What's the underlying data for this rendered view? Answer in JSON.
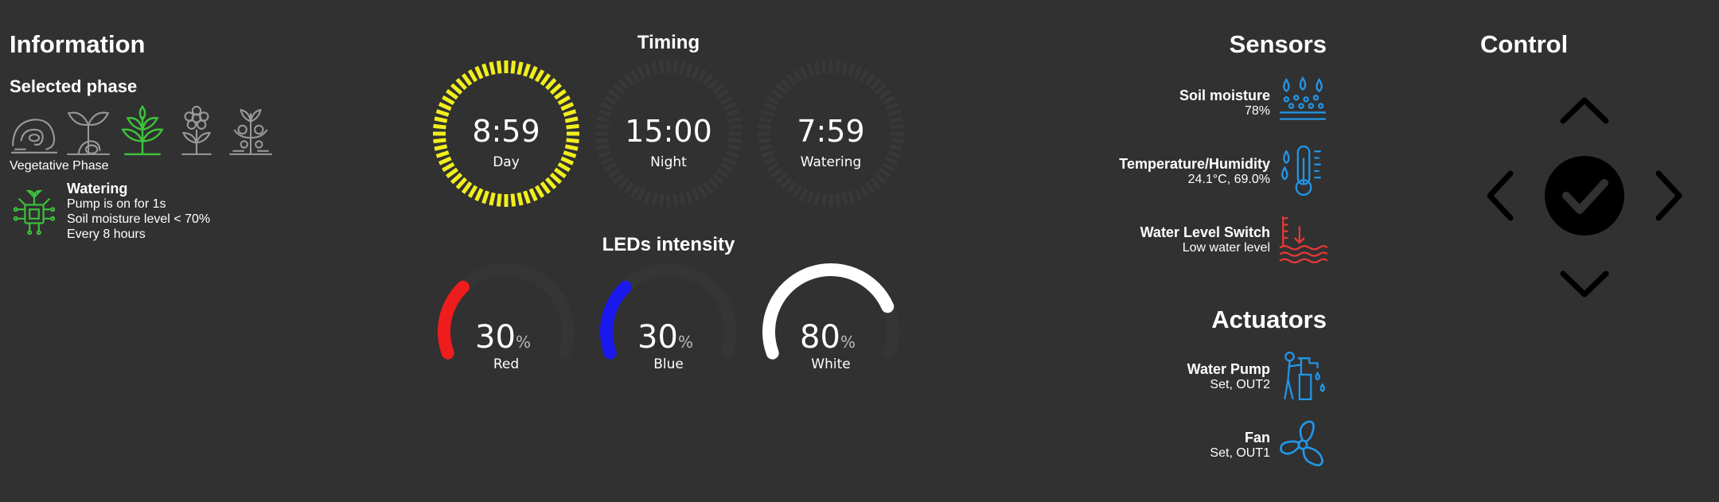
{
  "information": {
    "title": "Information",
    "selected_phase_label": "Selected phase",
    "phases": [
      "seed-icon",
      "seedling-icon",
      "vegetative-icon",
      "flowering-icon",
      "harvest-icon"
    ],
    "active_phase_index": 2,
    "phase_name": "Vegetative Phase",
    "watering": {
      "title": "Watering",
      "line1": "Pump is on for 1s",
      "line2": "Soil moisture level < 70%",
      "line3": "Every 8 hours"
    }
  },
  "timing": {
    "title": "Timing",
    "gauges": [
      {
        "value": "8:59",
        "label": "Day",
        "color": "#f2ee1c",
        "fill": 1.0
      },
      {
        "value": "15:00",
        "label": "Night",
        "color": "#3a3a3a",
        "fill": 0.0
      },
      {
        "value": "7:59",
        "label": "Watering",
        "color": "#3a3a3a",
        "fill": 0.0
      }
    ]
  },
  "leds": {
    "title": "LEDs intensity",
    "unit": "%",
    "channels": [
      {
        "value": "30",
        "label": "Red",
        "color": "#ee1c1c",
        "percent": 30
      },
      {
        "value": "30",
        "label": "Blue",
        "color": "#1a1aee",
        "percent": 30
      },
      {
        "value": "80",
        "label": "White",
        "color": "#ffffff",
        "percent": 80
      }
    ]
  },
  "sensors": {
    "title": "Sensors",
    "items": [
      {
        "name": "Soil moisture",
        "value": "78%",
        "icon": "soil-moisture-icon",
        "color": "#2196e8"
      },
      {
        "name": "Temperature/Humidity",
        "value": "24.1°C, 69.0%",
        "icon": "thermometer-icon",
        "color": "#2196e8"
      },
      {
        "name": "Water Level Switch",
        "value": "Low water level",
        "icon": "water-level-icon",
        "color": "#e53935"
      }
    ]
  },
  "actuators": {
    "title": "Actuators",
    "items": [
      {
        "name": "Water Pump",
        "value": "Set, OUT2",
        "icon": "water-pump-icon",
        "color": "#2196e8"
      },
      {
        "name": "Fan",
        "value": "Set, OUT1",
        "icon": "fan-icon",
        "color": "#2196e8"
      }
    ]
  },
  "control": {
    "title": "Control"
  }
}
